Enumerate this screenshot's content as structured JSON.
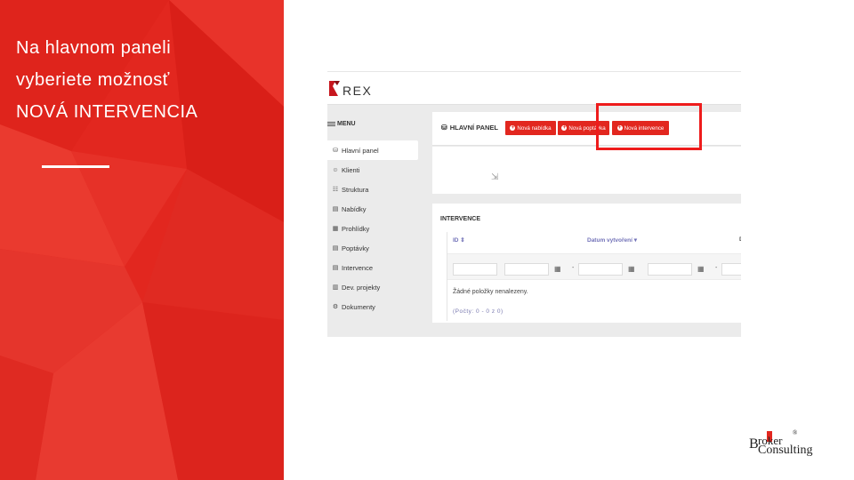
{
  "slide": {
    "lines": [
      "Na hlavnom paneli",
      "vyberiete možnosť",
      "NOVÁ INTERVENCIA"
    ]
  },
  "app": {
    "logo_text": "REX",
    "menu_label": "MENU",
    "sidebar": [
      {
        "label": "Hlavní panel",
        "icon": "dashboard-icon",
        "active": true
      },
      {
        "label": "Klienti",
        "icon": "users-icon",
        "active": false
      },
      {
        "label": "Struktura",
        "icon": "sitemap-icon",
        "active": false
      },
      {
        "label": "Nabídky",
        "icon": "document-icon",
        "active": false
      },
      {
        "label": "Prohlídky",
        "icon": "calendar-icon",
        "active": false
      },
      {
        "label": "Poptávky",
        "icon": "document-icon",
        "active": false
      },
      {
        "label": "Intervence",
        "icon": "document-icon",
        "active": false
      },
      {
        "label": "Dev. projekty",
        "icon": "building-icon",
        "active": false
      },
      {
        "label": "Dokumenty",
        "icon": "gear-icon",
        "active": false
      }
    ],
    "main_panel": {
      "title": "HLAVNÍ PANEL",
      "buttons": [
        "Nová nabídka",
        "Nová poptávka",
        "Nová intervence"
      ]
    },
    "intervence": {
      "title": "INTERVENCE",
      "columns": [
        "ID ⇕",
        "Datum vytvoření ▾",
        "D"
      ],
      "empty_message": "Žádné položky nenalezeny.",
      "count_text": "(Počty: 0 - 0 z 0)"
    }
  },
  "brand": {
    "accent": "#e2271f",
    "logo_first": "B",
    "logo_roker": "roker",
    "logo_consulting": "Consulting",
    "logo_mark": "®"
  }
}
